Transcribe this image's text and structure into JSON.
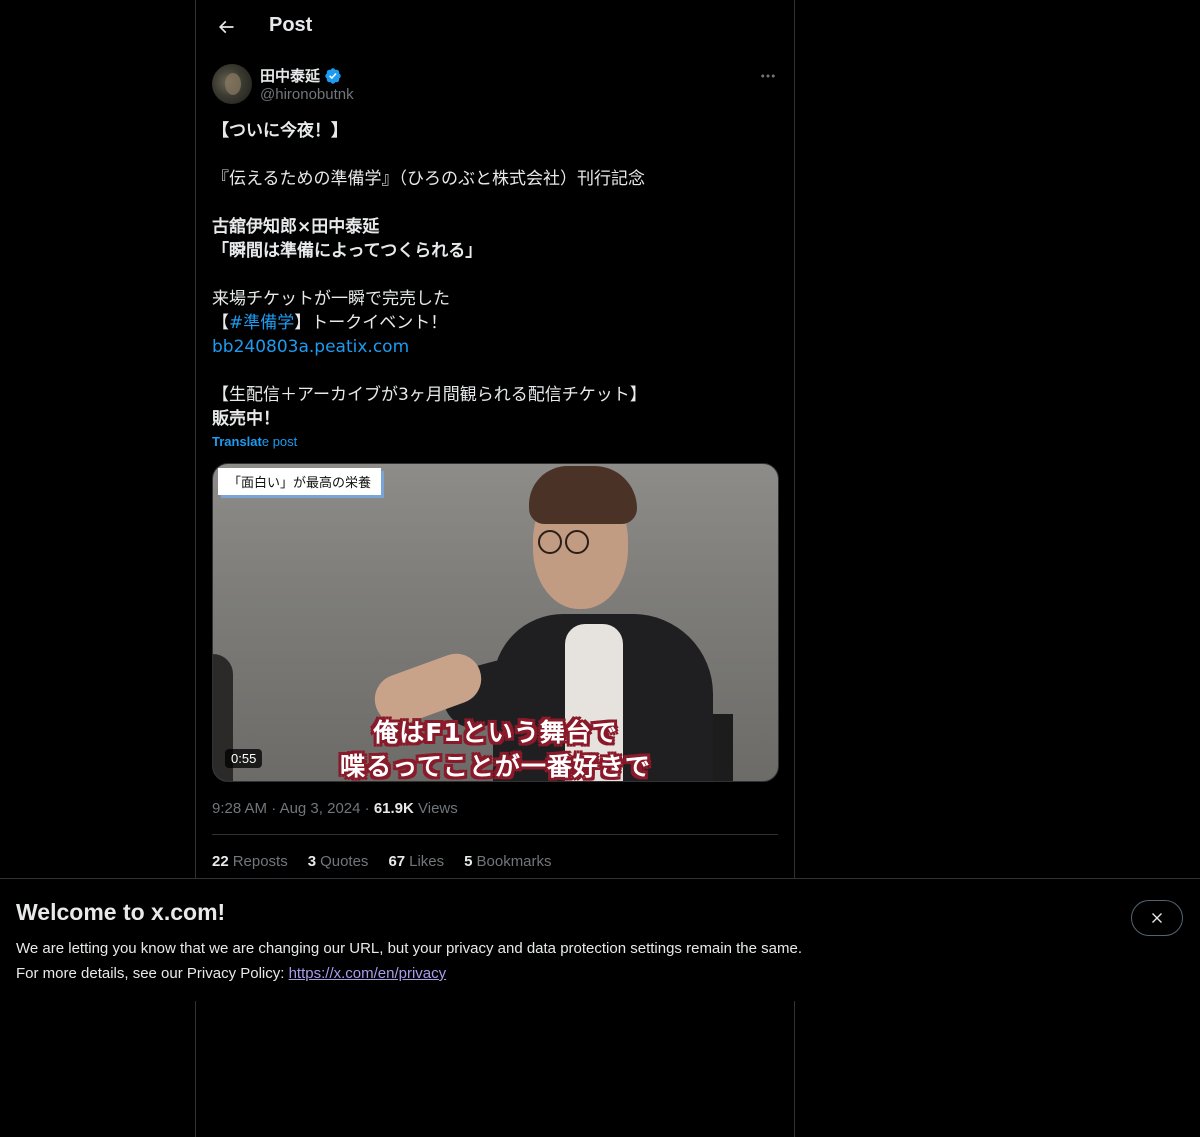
{
  "header": {
    "title": "Post",
    "back_icon": "arrow-left-icon"
  },
  "author": {
    "name": "田中泰延",
    "handle": "@hironobutnk",
    "verified": true
  },
  "tweet": {
    "lines": {
      "l1": "【ついに今夜！】",
      "l2": "『伝えるための準備学』（ひろのぶと株式会社）刊行記念",
      "l3": "古舘伊知郎×田中泰延",
      "l4": "「瞬間は準備によってつくられる」",
      "l5": "来場チケットが一瞬で完売した",
      "l6_pre": "【",
      "l6_hashtag": "#準備学",
      "l6_post": "】トークイベント！",
      "l7_link": "bb240803a.peatix.com",
      "l8": "【生配信＋アーカイブが3ヶ月間観られる配信チケット】",
      "l9": "販売中！"
    },
    "translate_bold": "Translat",
    "translate_rest": "e post"
  },
  "media": {
    "caption": "「面白い」が最高の栄養",
    "subtitle_1": "俺はF1という舞台で",
    "subtitle_2": "喋るってことが一番好きで",
    "duration": "0:55"
  },
  "meta": {
    "time": "9:28 AM",
    "sep": "·",
    "date": "Aug 3, 2024",
    "views_count": "61.9K",
    "views_label": "Views"
  },
  "stats": {
    "reposts_count": "22",
    "reposts_label": "Reposts",
    "quotes_count": "3",
    "quotes_label": "Quotes",
    "likes_count": "67",
    "likes_label": "Likes",
    "bookmarks_count": "5",
    "bookmarks_label": "Bookmarks"
  },
  "banner": {
    "title": "Welcome to x.com!",
    "line1": "We are letting you know that we are changing our URL, but your privacy and data protection settings remain the same.",
    "line2_pre": "For more details, see our Privacy Policy: ",
    "privacy_link": "https://x.com/en/privacy"
  },
  "colors": {
    "background": "#000000",
    "text": "#e7e9ea",
    "muted": "#71767b",
    "accent": "#1d9bf0",
    "border": "#2f3336",
    "link_visited": "#a99dec"
  }
}
